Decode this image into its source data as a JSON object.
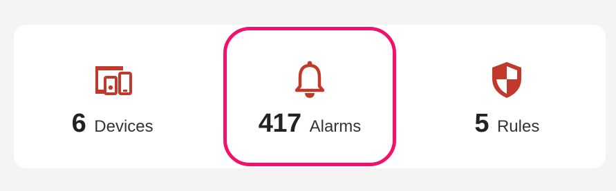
{
  "accent_color": "#c0392b",
  "highlight_color": "#f2116b",
  "stats": [
    {
      "count": "6",
      "label": "Devices",
      "icon": "devices-icon"
    },
    {
      "count": "417",
      "label": "Alarms",
      "icon": "bell-icon",
      "highlighted": true
    },
    {
      "count": "5",
      "label": "Rules",
      "icon": "shield-icon"
    }
  ]
}
